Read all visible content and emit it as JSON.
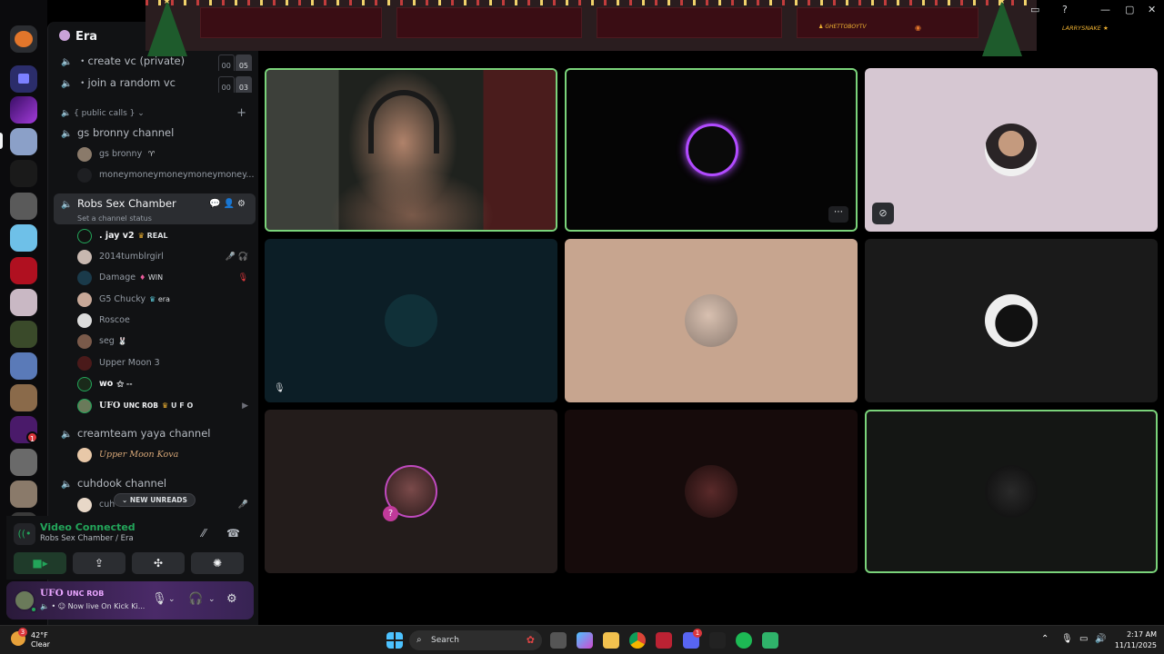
{
  "server": {
    "name": "Era"
  },
  "rail": {
    "badge": "1"
  },
  "channels": {
    "create_vc": "・create vc (private)",
    "create_vc_counts": [
      "00",
      "05"
    ],
    "join_random": "・join a random vc",
    "join_random_counts": [
      "00",
      "03"
    ],
    "category": "{ public calls }",
    "gs_bronny": "gs bronny channel",
    "gs_bronny_users": [
      "gs bronny",
      "moneymoneymoneymoneymoney..."
    ],
    "active": "Robs Sex Chamber",
    "active_status": "Set a channel status",
    "active_users": [
      {
        "name": ". jay v2",
        "tag": "REAL"
      },
      {
        "name": "2014tumblrgirl",
        "tag": ""
      },
      {
        "name": "Damage",
        "tag": "WIN"
      },
      {
        "name": "G5 Chucky",
        "tag": "era"
      },
      {
        "name": "Roscoe",
        "tag": ""
      },
      {
        "name": "seg",
        "tag": ""
      },
      {
        "name": "Upper Moon 3",
        "tag": ""
      },
      {
        "name": "wo",
        "tag": "--"
      },
      {
        "name": "UFO",
        "name_small": "UNC ROB",
        "tag": "U F O"
      }
    ],
    "creamteam": "creamteam yaya channel",
    "creamteam_user": "Upper Moon Kova",
    "cuhdook": "cuhdook channel",
    "cuhdook_user": "cuh",
    "new_unreads": "NEW UNREADS"
  },
  "voice": {
    "status": "Video Connected",
    "location": "Robs Sex Chamber / Era"
  },
  "user_panel": {
    "name": "UFO",
    "name_small": "UNC ROB",
    "status": "Now live On Kick Ki..."
  },
  "banner": {
    "name_left": "GHETTOBOYTV",
    "name_right": "LARRYSNAKE"
  },
  "taskbar": {
    "temp": "42°F",
    "condition": "Clear",
    "weather_badge": "3",
    "search_placeholder": "Search",
    "time": "2:17 AM",
    "date": "11/11/2025",
    "discord_badge": "1"
  },
  "colors": {
    "speaking_border": "#7ad37a",
    "connected_green": "#23a55a",
    "accent_purple": "#e9a6ff"
  }
}
